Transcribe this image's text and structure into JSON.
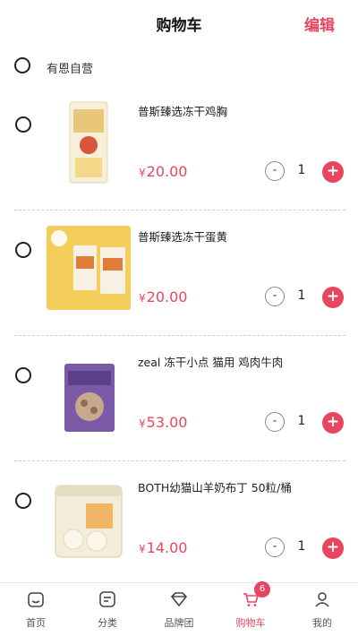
{
  "header": {
    "title": "购物车",
    "edit_label": "编辑"
  },
  "store": {
    "name": "有恩自营"
  },
  "currency": "¥",
  "items": [
    {
      "name": "普斯臻选冻干鸡胸",
      "price": "20.00",
      "qty": "1"
    },
    {
      "name": "普斯臻选冻干蛋黄",
      "price": "20.00",
      "qty": "1"
    },
    {
      "name": "zeal 冻干小点 猫用 鸡肉牛肉",
      "price": "53.00",
      "qty": "1"
    },
    {
      "name": "BOTH幼猫山羊奶布丁 50粒/桶",
      "price": "14.00",
      "qty": "1"
    }
  ],
  "stepper": {
    "minus": "-",
    "plus": "+"
  },
  "tabbar": {
    "tabs": [
      {
        "label": "首页",
        "icon": "home-icon"
      },
      {
        "label": "分类",
        "icon": "category-icon"
      },
      {
        "label": "品牌团",
        "icon": "diamond-icon"
      },
      {
        "label": "购物车",
        "icon": "cart-icon",
        "badge": "6"
      },
      {
        "label": "我的",
        "icon": "profile-icon"
      }
    ]
  },
  "colors": {
    "accent": "#e8465e"
  }
}
